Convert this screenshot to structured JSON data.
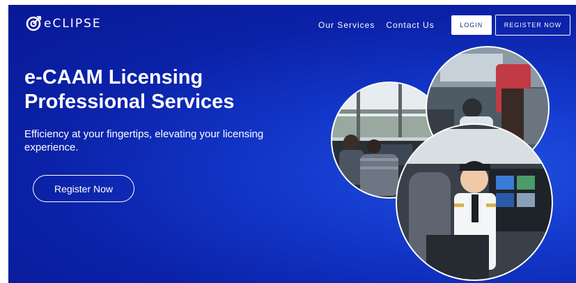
{
  "brand": {
    "name": "eCLIPSE"
  },
  "nav": {
    "links": [
      "Our Services",
      "Contact Us"
    ],
    "login": "LOGIN",
    "register": "REGISTER NOW"
  },
  "hero": {
    "title_line1": "e-CAAM Licensing",
    "title_line2": "Professional Services",
    "subtitle": "Efficiency at your fingertips, elevating your licensing experience.",
    "cta": "Register Now"
  },
  "photos": [
    {
      "name": "air-traffic-control-tower-photo"
    },
    {
      "name": "aircraft-maintenance-photo"
    },
    {
      "name": "pilot-in-cockpit-photo"
    }
  ],
  "colors": {
    "accent": "#0b22a8",
    "accent_light": "#1f4fe0",
    "button_text": "#1a2f8a"
  }
}
